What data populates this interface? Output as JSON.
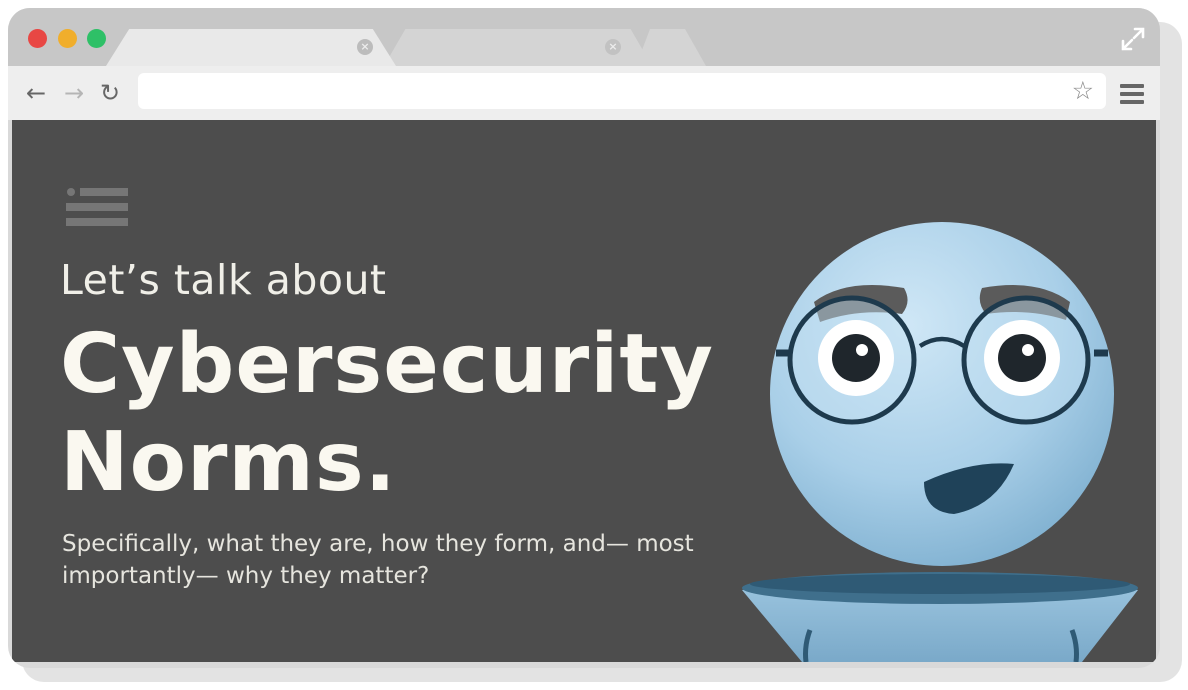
{
  "browser": {
    "tabs": [
      {
        "label": "",
        "active": true
      },
      {
        "label": "",
        "active": false
      },
      {
        "label": "",
        "active": false
      }
    ],
    "controls": {
      "close_color": "#e84744",
      "minimize_color": "#f0ae2c",
      "maximize_color": "#2ec067"
    },
    "nav": {
      "back_icon": "←",
      "forward_icon": "→",
      "reload_icon": "↻"
    },
    "address": {
      "value": "",
      "placeholder": ""
    },
    "icons": {
      "bookmark": "star-icon",
      "menu": "hamburger-menu-icon",
      "expand": "expand-icon",
      "tab_close": "×"
    }
  },
  "page": {
    "background": "#4d4d4d",
    "pretitle": "Let’s talk about",
    "title": "Cybersecurity Norms.",
    "subtitle": "Specifically, what they are, how they form, and— most importantly— why they matter?",
    "illustration": "robot-illustration"
  }
}
